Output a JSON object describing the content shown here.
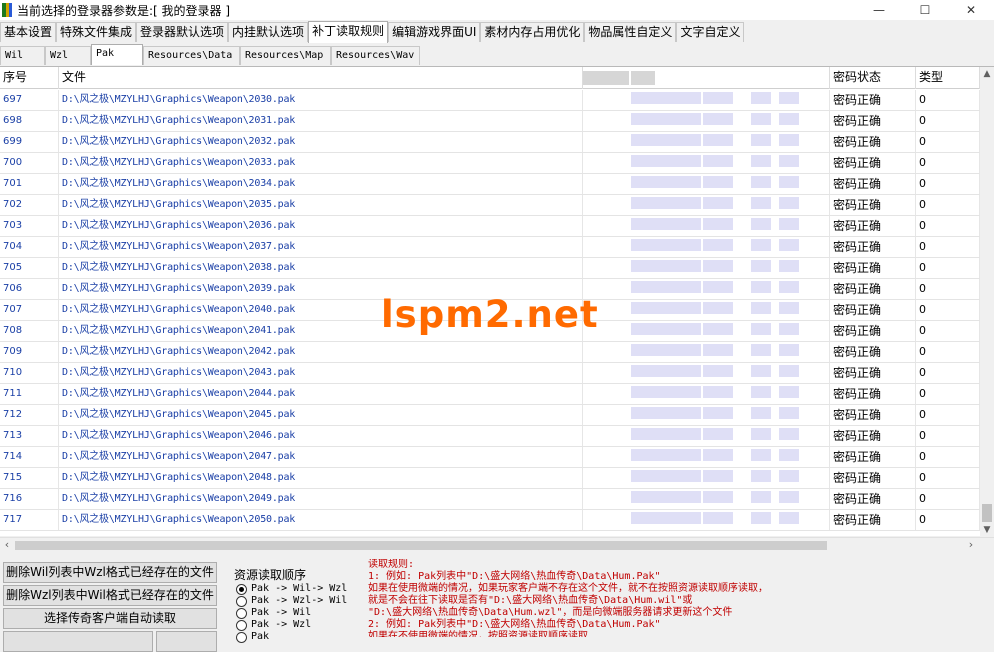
{
  "window": {
    "title": "当前选择的登录器参数是:[ 我的登录器 ]",
    "controls": {
      "minimize": "—",
      "maximize": "☐",
      "close": "✕"
    }
  },
  "main_tabs": [
    {
      "label": "基本设置",
      "active": false
    },
    {
      "label": "特殊文件集成",
      "active": false
    },
    {
      "label": "登录器默认选项",
      "active": false
    },
    {
      "label": "内挂默认选项",
      "active": false
    },
    {
      "label": "补丁读取规则",
      "active": true
    },
    {
      "label": "编辑游戏界面UI",
      "active": false
    },
    {
      "label": "素材内存占用优化",
      "active": false
    },
    {
      "label": "物品属性自定义",
      "active": false
    },
    {
      "label": "文字自定义",
      "active": false
    }
  ],
  "sub_tabs": [
    {
      "label": "Wil",
      "active": false
    },
    {
      "label": "Wzl",
      "active": false
    },
    {
      "label": "Pak",
      "active": true
    },
    {
      "label": "Resources\\Data",
      "active": false
    },
    {
      "label": "Resources\\Map",
      "active": false
    },
    {
      "label": "Resources\\Wav",
      "active": false
    }
  ],
  "table": {
    "columns": {
      "no": "序号",
      "file": "文件",
      "status": "密码状态",
      "type": "类型"
    },
    "rows": [
      {
        "no": "697",
        "file": "D:\\风之极\\MZYLHJ\\Graphics\\Weapon\\2030.pak",
        "status": "密码正确",
        "type": "0"
      },
      {
        "no": "698",
        "file": "D:\\风之极\\MZYLHJ\\Graphics\\Weapon\\2031.pak",
        "status": "密码正确",
        "type": "0"
      },
      {
        "no": "699",
        "file": "D:\\风之极\\MZYLHJ\\Graphics\\Weapon\\2032.pak",
        "status": "密码正确",
        "type": "0"
      },
      {
        "no": "700",
        "file": "D:\\风之极\\MZYLHJ\\Graphics\\Weapon\\2033.pak",
        "status": "密码正确",
        "type": "0"
      },
      {
        "no": "701",
        "file": "D:\\风之极\\MZYLHJ\\Graphics\\Weapon\\2034.pak",
        "status": "密码正确",
        "type": "0"
      },
      {
        "no": "702",
        "file": "D:\\风之极\\MZYLHJ\\Graphics\\Weapon\\2035.pak",
        "status": "密码正确",
        "type": "0"
      },
      {
        "no": "703",
        "file": "D:\\风之极\\MZYLHJ\\Graphics\\Weapon\\2036.pak",
        "status": "密码正确",
        "type": "0"
      },
      {
        "no": "704",
        "file": "D:\\风之极\\MZYLHJ\\Graphics\\Weapon\\2037.pak",
        "status": "密码正确",
        "type": "0"
      },
      {
        "no": "705",
        "file": "D:\\风之极\\MZYLHJ\\Graphics\\Weapon\\2038.pak",
        "status": "密码正确",
        "type": "0"
      },
      {
        "no": "706",
        "file": "D:\\风之极\\MZYLHJ\\Graphics\\Weapon\\2039.pak",
        "status": "密码正确",
        "type": "0"
      },
      {
        "no": "707",
        "file": "D:\\风之极\\MZYLHJ\\Graphics\\Weapon\\2040.pak",
        "status": "密码正确",
        "type": "0"
      },
      {
        "no": "708",
        "file": "D:\\风之极\\MZYLHJ\\Graphics\\Weapon\\2041.pak",
        "status": "密码正确",
        "type": "0"
      },
      {
        "no": "709",
        "file": "D:\\风之极\\MZYLHJ\\Graphics\\Weapon\\2042.pak",
        "status": "密码正确",
        "type": "0"
      },
      {
        "no": "710",
        "file": "D:\\风之极\\MZYLHJ\\Graphics\\Weapon\\2043.pak",
        "status": "密码正确",
        "type": "0"
      },
      {
        "no": "711",
        "file": "D:\\风之极\\MZYLHJ\\Graphics\\Weapon\\2044.pak",
        "status": "密码正确",
        "type": "0"
      },
      {
        "no": "712",
        "file": "D:\\风之极\\MZYLHJ\\Graphics\\Weapon\\2045.pak",
        "status": "密码正确",
        "type": "0"
      },
      {
        "no": "713",
        "file": "D:\\风之极\\MZYLHJ\\Graphics\\Weapon\\2046.pak",
        "status": "密码正确",
        "type": "0"
      },
      {
        "no": "714",
        "file": "D:\\风之极\\MZYLHJ\\Graphics\\Weapon\\2047.pak",
        "status": "密码正确",
        "type": "0"
      },
      {
        "no": "715",
        "file": "D:\\风之极\\MZYLHJ\\Graphics\\Weapon\\2048.pak",
        "status": "密码正确",
        "type": "0"
      },
      {
        "no": "716",
        "file": "D:\\风之极\\MZYLHJ\\Graphics\\Weapon\\2049.pak",
        "status": "密码正确",
        "type": "0"
      },
      {
        "no": "717",
        "file": "D:\\风之极\\MZYLHJ\\Graphics\\Weapon\\2050.pak",
        "status": "密码正确",
        "type": "0"
      }
    ]
  },
  "buttons": {
    "delete_wil": "删除Wil列表中Wzl格式已经存在的文件",
    "delete_wzl": "删除Wzl列表中Wil格式已经存在的文件",
    "auto_read": "选择传奇客户端自动读取"
  },
  "read_order": {
    "title": "资源读取顺序",
    "options": [
      {
        "label": "Pak -> Wil-> Wzl",
        "checked": true
      },
      {
        "label": "Pak -> Wzl-> Wil",
        "checked": false
      },
      {
        "label": "Pak -> Wil",
        "checked": false
      },
      {
        "label": "Pak -> Wzl",
        "checked": false
      },
      {
        "label": "Pak",
        "checked": false
      }
    ]
  },
  "rules": {
    "lines": [
      "读取规则:",
      "1: 例如: Pak列表中\"D:\\盛大网络\\热血传奇\\Data\\Hum.Pak\"",
      "    如果在使用微端的情况，如果玩家客户端不存在这个文件，就不在按照资源读取顺序读取，",
      "    就是不会在往下读取是否有\"D:\\盛大网络\\热血传奇\\Data\\Hum.wil\"或",
      "  \"D:\\盛大网络\\热血传奇\\Data\\Hum.wzl\"，而是向微端服务器请求更新这个文件",
      "2: 例如: Pak列表中\"D:\\盛大网络\\热血传奇\\Data\\Hum.Pak\"",
      "    如果在不使用微端的情况，按照资源读取顺序读取"
    ]
  },
  "watermark": "lspm2.net"
}
